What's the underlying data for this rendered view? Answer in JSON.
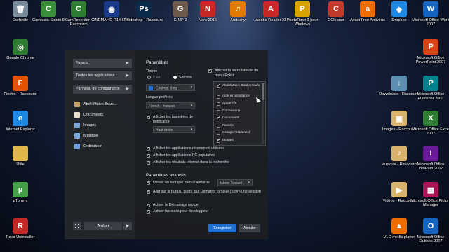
{
  "desktop": {
    "icons": [
      {
        "label": "Corbeille",
        "icon": "recycle-bin-icon",
        "color": "#7a8b9a",
        "glyph": "🗑"
      },
      {
        "label": "Camtasia Studio 8",
        "icon": "camtasia-icon",
        "color": "#3a8f3a",
        "glyph": "C"
      },
      {
        "label": "CamRecorder - Raccourci",
        "icon": "camrecorder-icon",
        "color": "#2e7d32",
        "glyph": "C"
      },
      {
        "label": "CINEMA 4D R14 64 Bit",
        "icon": "cinema4d-icon",
        "color": "#1b3a8a",
        "glyph": "◉"
      },
      {
        "label": "Photoshop - Raccourci",
        "icon": "photoshop-icon",
        "color": "#0a2a4a",
        "glyph": "Ps"
      },
      {
        "label": "GIMP 2",
        "icon": "gimp-icon",
        "color": "#6d5a4a",
        "glyph": "G"
      },
      {
        "label": "Nero 2015",
        "icon": "nero-icon",
        "color": "#c62828",
        "glyph": "N"
      },
      {
        "label": "Audacity",
        "icon": "audacity-icon",
        "color": "#e07b00",
        "glyph": "♫"
      },
      {
        "label": "Adobe Reader XI",
        "icon": "adobe-reader-icon",
        "color": "#c62828",
        "glyph": "A"
      },
      {
        "label": "PhotoRecit 3 pour Windows",
        "icon": "photorecit-icon",
        "color": "#d9a400",
        "glyph": "P"
      },
      {
        "label": "CCleaner",
        "icon": "ccleaner-icon",
        "color": "#c0392b",
        "glyph": "C"
      },
      {
        "label": "Avast Free Antivirus",
        "icon": "avast-icon",
        "color": "#ef6c00",
        "glyph": "a"
      },
      {
        "label": "Dropbox",
        "icon": "dropbox-icon",
        "color": "#1e88e5",
        "glyph": "◆"
      },
      {
        "label": "Microsoft Office Word 2007",
        "icon": "word-icon",
        "color": "#1565c0",
        "glyph": "W"
      },
      {
        "label": "Google Chrome",
        "icon": "chrome-icon",
        "color": "#2e7d32",
        "glyph": "◎"
      },
      {
        "label": "Microsoft Office PowerPoint 2007",
        "icon": "powerpoint-icon",
        "color": "#d84315",
        "glyph": "P"
      },
      {
        "label": "Firefox - Raccourci",
        "icon": "firefox-icon",
        "color": "#e65100",
        "glyph": "F"
      },
      {
        "label": "Downloads - Raccourci",
        "icon": "downloads-folder-icon",
        "color": "#5c8fb0",
        "glyph": "↓"
      },
      {
        "label": "Microsoft Office Publisher 2007",
        "icon": "publisher-icon",
        "color": "#00838f",
        "glyph": "P"
      },
      {
        "label": "Internet Explorer",
        "icon": "ie-icon",
        "color": "#1e88e5",
        "glyph": "e"
      },
      {
        "label": "Images - Raccourci",
        "icon": "images-folder-icon",
        "color": "#d9b36c",
        "glyph": "▣"
      },
      {
        "label": "Microsoft Office Excel 2007",
        "icon": "excel-icon",
        "color": "#2e7d32",
        "glyph": "X"
      },
      {
        "label": "Utile",
        "icon": "folder-icon",
        "color": "#e0b64a",
        "glyph": ""
      },
      {
        "label": "Musique - Raccourci",
        "icon": "music-folder-icon",
        "color": "#d9b36c",
        "glyph": "♪"
      },
      {
        "label": "Microsoft Office InfoPath 2007",
        "icon": "infopath-icon",
        "color": "#6a1b9a",
        "glyph": "I"
      },
      {
        "label": "µTorrent",
        "icon": "utorrent-icon",
        "color": "#43a047",
        "glyph": "µ"
      },
      {
        "label": "Vidéos - Raccourci",
        "icon": "videos-folder-icon",
        "color": "#d9b36c",
        "glyph": "▶"
      },
      {
        "label": "Microsoft Office Picture Manager",
        "icon": "picture-manager-icon",
        "color": "#ad1457",
        "glyph": "▦"
      },
      {
        "label": "Revo Uninstaller",
        "icon": "revo-icon",
        "color": "#c62828",
        "glyph": "R"
      },
      {
        "label": "VLC media player",
        "icon": "vlc-icon",
        "color": "#ef6c00",
        "glyph": "▲"
      },
      {
        "label": "Microsoft Office Outlook 2007",
        "icon": "outlook-icon",
        "color": "#1565c0",
        "glyph": "O"
      }
    ]
  },
  "menu": {
    "nav": {
      "favorites": "Favoris",
      "all_apps": "Toutes les applications",
      "control_panel": "Panneau de configuration"
    },
    "libraries": [
      {
        "label": "AbdelMalek Bouk...",
        "icon": "user-folder-icon",
        "color": "#c9a36a"
      },
      {
        "label": "Documents",
        "icon": "documents-icon",
        "color": "#e8e0c8"
      },
      {
        "label": "Images",
        "icon": "images-icon",
        "color": "#7aa7d6"
      },
      {
        "label": "Musique",
        "icon": "music-icon",
        "color": "#7aa7d6"
      },
      {
        "label": "Ordinateur",
        "icon": "computer-icon",
        "color": "#6fa0d8"
      }
    ],
    "settings": {
      "title": "Paramètres",
      "theme_label": "Thème",
      "theme_light": "Clair",
      "theme_dark": "Sombre",
      "color_value": "Couleur: Bleu",
      "color_swatch": "#1f6fd1",
      "lang_label": "Langue préférée",
      "lang_value": "French - français",
      "show_notif_label": "Afficher les bannières de notification",
      "notif_pos": "Haut droite",
      "show_sidebar_label": "Afficher la barre latérale du menu Pokki",
      "sidebar_items": [
        {
          "label": "AbdelMalek Boukersoufa",
          "checked": true,
          "dim": false
        },
        {
          "label": "Aide et assistance",
          "checked": false,
          "dim": true
        },
        {
          "label": "Appareils",
          "checked": false,
          "dim": true
        },
        {
          "label": "Connexions",
          "checked": false,
          "dim": false
        },
        {
          "label": "Documents",
          "checked": true,
          "dim": false
        },
        {
          "label": "Favoris",
          "checked": false,
          "dim": true
        },
        {
          "label": "Groupe résidentiel",
          "checked": false,
          "dim": true
        },
        {
          "label": "Images",
          "checked": true,
          "dim": false
        }
      ],
      "options": [
        "Afficher les applications récemment utilisées",
        "Afficher les applications PC populaires",
        "Afficher les résultats Internet dans la recherche"
      ],
      "advanced_title": "Paramètres avancés",
      "use_instead_label": "Utiliser en tant que menu Démarrer",
      "icon_value": "Icône: Accueil",
      "desktop_label": "Aller sur le bureau plutôt que Démarrer lorsque j'ouvre une session",
      "fast_start_label": "Activer le Démarrage rapide",
      "dev_tools_label": "Activer les outils pour développeur"
    },
    "buttons": {
      "stop": "Arrêter",
      "save": "Enregistrer",
      "cancel": "Annuler"
    }
  }
}
